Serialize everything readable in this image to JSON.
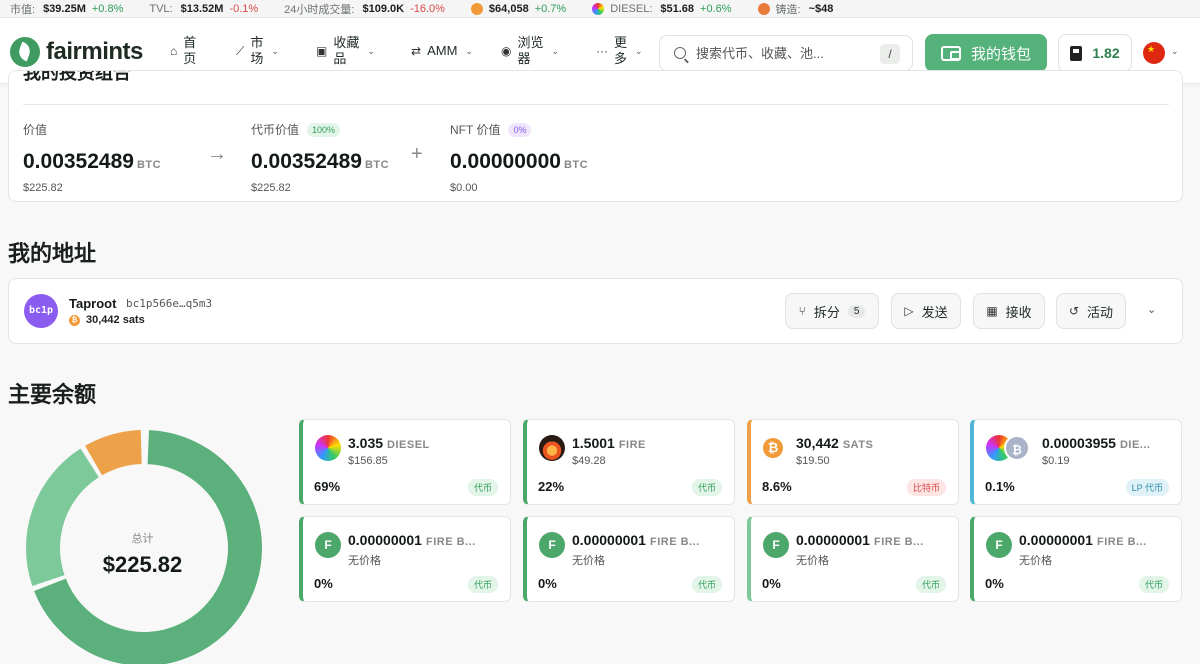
{
  "ticker": [
    {
      "label": "市值:",
      "value": "$39.25M",
      "change": "+0.8%",
      "dir": "pos",
      "icon": ""
    },
    {
      "label": "TVL:",
      "value": "$13.52M",
      "change": "-0.1%",
      "dir": "neg",
      "icon": ""
    },
    {
      "label": "24小时成交量:",
      "value": "$109.0K",
      "change": "-16.0%",
      "dir": "neg",
      "icon": ""
    },
    {
      "label": "",
      "value": "$64,058",
      "change": "+0.7%",
      "dir": "pos",
      "icon": "bitcoin-icon"
    },
    {
      "label": "DIESEL:",
      "value": "$51.68",
      "change": "+0.6%",
      "dir": "pos",
      "icon": "diesel-icon"
    },
    {
      "label": "铸造:",
      "value": "~$48",
      "change": "",
      "dir": "",
      "icon": "pickaxe-icon"
    }
  ],
  "nav": {
    "logo_text": "fairmints",
    "items": [
      {
        "label": "首\n页",
        "icon": "home-icon"
      },
      {
        "label": "市\n场",
        "icon": "chart-icon"
      },
      {
        "label": "收藏\n品",
        "icon": "collection-icon"
      },
      {
        "label": "AMM",
        "icon": "swap-icon"
      },
      {
        "label": "浏览\n器",
        "icon": "compass-icon"
      },
      {
        "label": "更\n多",
        "icon": "more-icon"
      }
    ],
    "search_placeholder": "搜索代币、收藏、池...",
    "search_shortcut": "/",
    "wallet_label": "我的钱包",
    "gas_value": "1.82"
  },
  "portfolio": {
    "title": "我的投资组合",
    "value_label": "价值",
    "value": "0.00352489",
    "unit": "BTC",
    "value_usd": "$225.82",
    "token_label": "代币价值",
    "token_pct": "100%",
    "token_value": "0.00352489",
    "token_usd": "$225.82",
    "nft_label": "NFT 价值",
    "nft_pct": "0%",
    "nft_value": "0.00000000",
    "nft_usd": "$0.00"
  },
  "addresses": {
    "heading": "我的地址",
    "avatar_text": "bc1p",
    "type": "Taproot",
    "address": "bc1p566e…q5m3",
    "sats": "30,442 sats",
    "buttons": {
      "split": "拆分",
      "split_count": "5",
      "send": "发送",
      "receive": "接收",
      "activity": "活动"
    }
  },
  "balances": {
    "heading": "主要余额",
    "total_label": "总计",
    "total_value": "$225.82",
    "donut": [
      {
        "name": "DIESEL",
        "pct": 69.1,
        "color": "#5bb07b"
      },
      {
        "name": "FIRE",
        "pct": 21.9,
        "color": "#7dc99a"
      },
      {
        "name": "SATS",
        "pct": 8.6,
        "color": "#eda24a"
      },
      {
        "name": "LP",
        "pct": 0.4,
        "color": "#6fc0d8"
      }
    ],
    "cards": [
      {
        "amount": "3.035",
        "symbol": "DIESEL",
        "usd": "$156.85",
        "pct": "69%",
        "badge": "代币",
        "badge_class": "b-green",
        "border": "#4ca86a",
        "icon": "diesel-icon"
      },
      {
        "amount": "1.5001",
        "symbol": "FIRE",
        "usd": "$49.28",
        "pct": "22%",
        "badge": "代币",
        "badge_class": "b-green",
        "border": "#4ca86a",
        "icon": "fire-icon"
      },
      {
        "amount": "30,442",
        "symbol": "SATS",
        "usd": "$19.50",
        "pct": "8.6%",
        "badge": "比特币",
        "badge_class": "b-red",
        "border": "#eda24a",
        "icon": "bitcoin-icon"
      },
      {
        "amount": "0.00003955",
        "symbol": "DIE...",
        "usd": "$0.19",
        "pct": "0.1%",
        "badge": "LP 代币",
        "badge_class": "b-blue",
        "border": "#4fb7d4",
        "icon": "lp-pair-icon"
      },
      {
        "amount": "0.00000001",
        "symbol": "FIRE B...",
        "usd": "无价格",
        "pct": "0%",
        "badge": "代币",
        "badge_class": "b-green",
        "border": "#4ca86a",
        "icon": "fire-b-icon"
      },
      {
        "amount": "0.00000001",
        "symbol": "FIRE B...",
        "usd": "无价格",
        "pct": "0%",
        "badge": "代币",
        "badge_class": "b-green",
        "border": "#4ca86a",
        "icon": "fire-b-icon"
      },
      {
        "amount": "0.00000001",
        "symbol": "FIRE B...",
        "usd": "无价格",
        "pct": "0%",
        "badge": "代币",
        "badge_class": "b-green",
        "border": "#7dc99a",
        "icon": "fire-b-icon"
      },
      {
        "amount": "0.00000001",
        "symbol": "FIRE B...",
        "usd": "无价格",
        "pct": "0%",
        "badge": "代币",
        "badge_class": "b-green",
        "border": "#4ca86a",
        "icon": "fire-b-icon"
      }
    ]
  }
}
